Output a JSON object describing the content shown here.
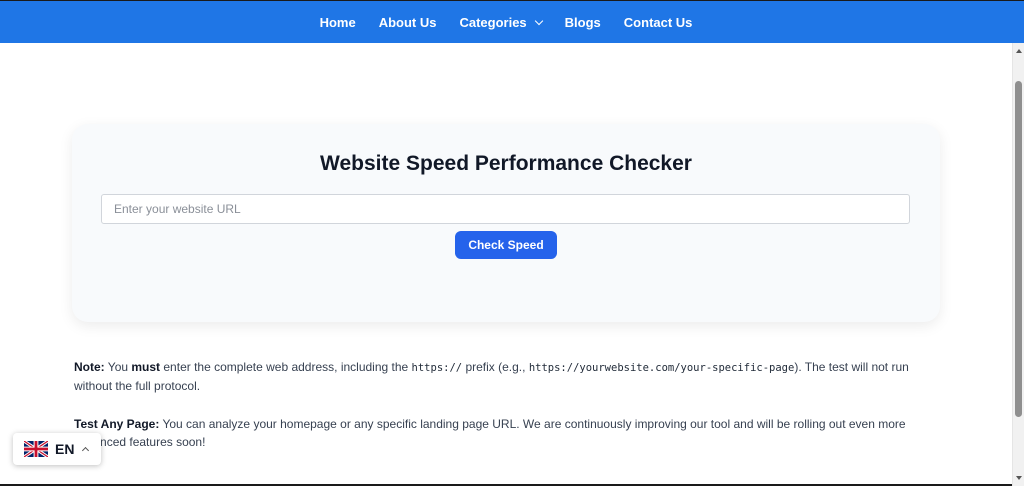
{
  "nav": {
    "items": [
      {
        "label": "Home"
      },
      {
        "label": "About Us"
      },
      {
        "label": "Categories",
        "has_dropdown": true
      },
      {
        "label": "Blogs"
      },
      {
        "label": "Contact Us"
      }
    ]
  },
  "checker": {
    "title": "Website Speed Performance Checker",
    "input_placeholder": "Enter your website URL",
    "input_value": "",
    "button_label": "Check Speed"
  },
  "note": {
    "label": "Note:",
    "text_1": " You ",
    "emphasis": "must",
    "text_2": " enter the complete web address, including the ",
    "prefix_code": "https://",
    "text_3": " prefix (e.g., ",
    "example_code": "https://yourwebsite.com/your-specific-page",
    "text_4": "). The test will not run without the full protocol."
  },
  "test_any_page": {
    "label": "Test Any Page:",
    "text": " You can analyze your homepage or any specific landing page URL. We are continuously improving our tool and will be rolling out even more advanced features soon!"
  },
  "language": {
    "code": "EN",
    "flag_icon": "uk-flag-icon"
  },
  "colors": {
    "nav_background": "#1f76e6",
    "button": "#2563eb",
    "card_background": "#f8fafc"
  }
}
